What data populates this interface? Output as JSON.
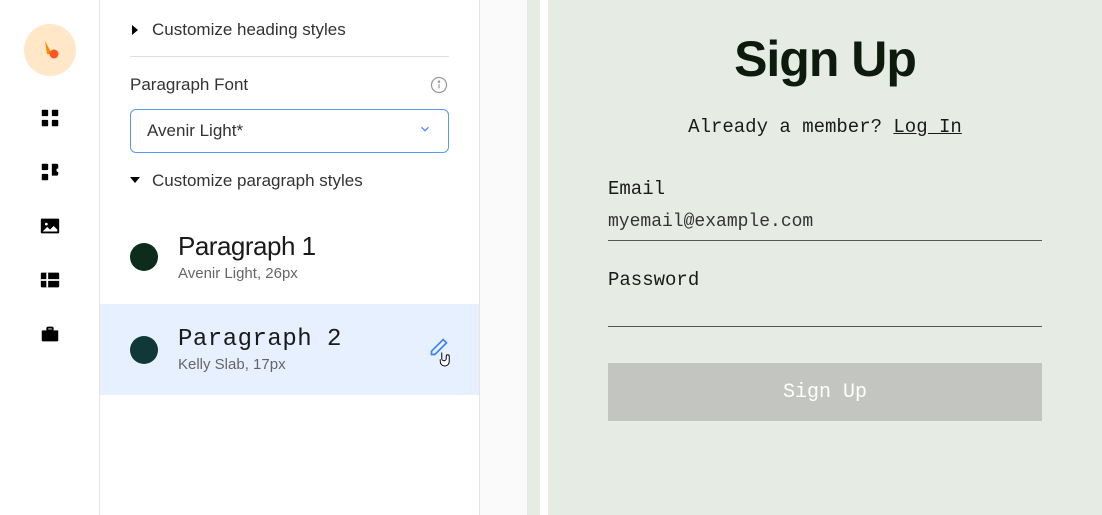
{
  "panel": {
    "customize_heading_label": "Customize heading styles",
    "paragraph_font_label": "Paragraph Font",
    "selected_font": "Avenir Light*",
    "customize_paragraph_label": "Customize paragraph styles",
    "styles": [
      {
        "name": "Paragraph 1",
        "meta": "Avenir Light, 26px",
        "swatch": "#0c2d1c"
      },
      {
        "name": "Paragraph 2",
        "meta": "Kelly Slab, 17px",
        "swatch": "#113838"
      }
    ]
  },
  "preview": {
    "title": "Sign Up",
    "already_member": "Already a member? ",
    "login_link": "Log In",
    "email_label": "Email",
    "email_value": "myemail@example.com",
    "password_label": "Password",
    "signup_button": "Sign Up"
  }
}
